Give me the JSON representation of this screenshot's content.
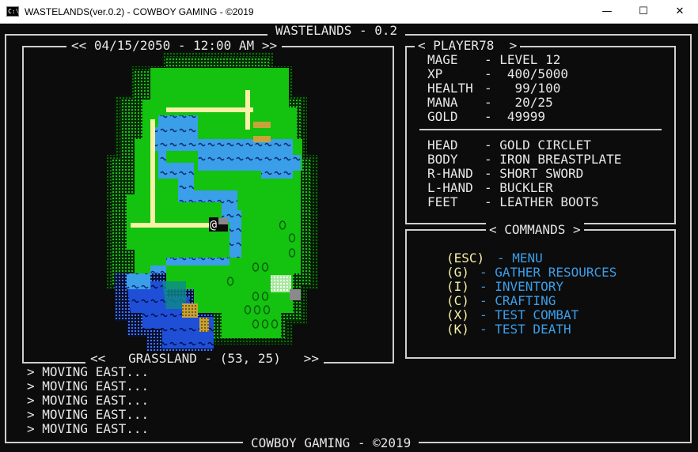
{
  "window": {
    "title": "WASTELANDS(ver.0.2) - COWBOY GAMING - ©2019",
    "icon": "console-icon",
    "minimize": "—",
    "maximize": "☐",
    "close": "✕"
  },
  "game": {
    "title": "WASTELANDS - 0.2",
    "footer": "COWBOY GAMING - ©2019",
    "datetime": "<< 04/15/2050 - 12:00 AM >>",
    "location": "<<   GRASSLAND - (53, 25)   >>",
    "player_marker": "@"
  },
  "player": {
    "header": "< PLAYER78  >",
    "stats": [
      {
        "label": "MAGE",
        "value": "- LEVEL 12"
      },
      {
        "label": "XP",
        "value": "-  400/5000"
      },
      {
        "label": "HEALTH",
        "value": "-   99/100"
      },
      {
        "label": "MANA",
        "value": "-   20/25"
      },
      {
        "label": "GOLD",
        "value": "-  49999"
      }
    ],
    "equipment": [
      {
        "slot": "HEAD",
        "item": "- GOLD CIRCLET"
      },
      {
        "slot": "BODY",
        "item": "- IRON BREASTPLATE"
      },
      {
        "slot": "R-HAND",
        "item": "- SHORT SWORD"
      },
      {
        "slot": "L-HAND",
        "item": "- BUCKLER"
      },
      {
        "slot": "FEET",
        "item": "- LEATHER BOOTS"
      }
    ]
  },
  "commands": {
    "header": "< COMMANDS >",
    "items": [
      {
        "key": "(ESC)",
        "label": "- MENU"
      },
      {
        "key": "(G)",
        "label": "- GATHER RESOURCES"
      },
      {
        "key": "(I)",
        "label": "- INVENTORY"
      },
      {
        "key": "(C)",
        "label": "- CRAFTING"
      },
      {
        "key": "(X)",
        "label": "- TEST COMBAT"
      },
      {
        "key": "(K)",
        "label": "- TEST DEATH"
      }
    ]
  },
  "log": [
    "> MOVING EAST...",
    "> MOVING EAST...",
    "> MOVING EAST...",
    "> MOVING EAST...",
    "> MOVING EAST..."
  ],
  "colors": {
    "text": "#e6e6e6",
    "key": "#f9f1a5",
    "command": "#3b9ee9",
    "grass": "#13c30f",
    "water": "#3b78ff",
    "road": "#f9f1a5",
    "sand": "#c8a33a"
  }
}
